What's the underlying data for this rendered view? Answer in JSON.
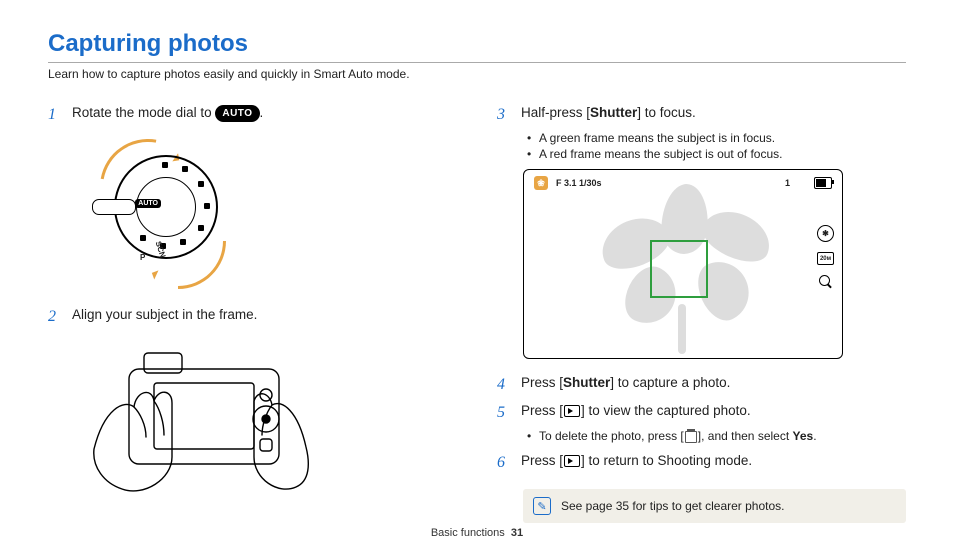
{
  "title": "Capturing photos",
  "subtitle": "Learn how to capture photos easily and quickly in Smart Auto mode.",
  "steps": {
    "s1": {
      "num": "1",
      "pre": "Rotate the mode dial to ",
      "badge": "AUTO",
      "post": "."
    },
    "s2": {
      "num": "2",
      "text": "Align your subject in the frame."
    },
    "s3": {
      "num": "3",
      "pre": "Half-press [",
      "bold": "Shutter",
      "post": "] to focus.",
      "b1": "A green frame means the subject is in focus.",
      "b2": "A red frame means the subject is out of focus."
    },
    "s4": {
      "num": "4",
      "pre": "Press [",
      "bold": "Shutter",
      "post": "] to capture a photo."
    },
    "s5": {
      "num": "5",
      "pre": "Press [",
      "post": "] to view the captured photo.",
      "sub_pre": "To delete the photo, press [",
      "sub_mid": "], and then select ",
      "sub_bold": "Yes",
      "sub_post": "."
    },
    "s6": {
      "num": "6",
      "pre": "Press [",
      "post": "] to return to Shooting mode."
    }
  },
  "lcd": {
    "exposure": "F 3.1  1/30s",
    "count": "1"
  },
  "dial": {
    "auto": "AUTO",
    "m1": "SCN",
    "m2": "P"
  },
  "note": "See page 35 for tips to get clearer photos.",
  "footer": {
    "section": "Basic functions",
    "page": "31"
  }
}
